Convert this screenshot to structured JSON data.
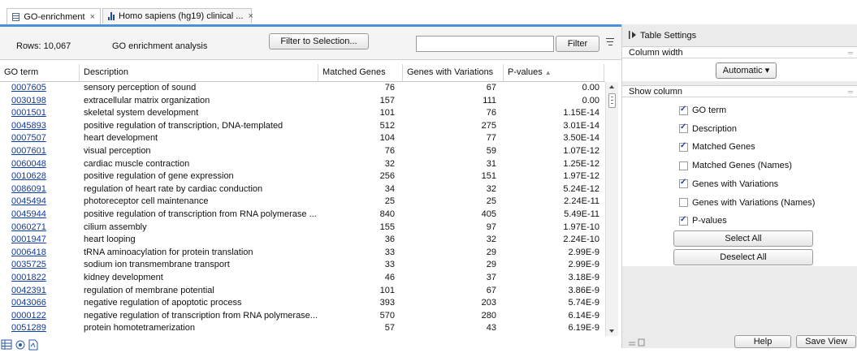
{
  "tabs": [
    {
      "label": "GO-enrichment",
      "icon": "table-icon",
      "close": "×"
    },
    {
      "label": "Homo sapiens (hg19) clinical ...",
      "icon": "bar-chart-icon",
      "close": "×"
    }
  ],
  "toolbar": {
    "rows_label": "Rows: 10,067",
    "analysis_label": "GO enrichment analysis",
    "filter_selection_button": "Filter to Selection...",
    "filter_input_value": "",
    "filter_button": "Filter"
  },
  "table": {
    "columns": [
      "GO term",
      "Description",
      "Matched Genes",
      "Genes with Variations",
      "P-values"
    ],
    "sort_indicator": "▲",
    "rows": [
      [
        "0007605",
        "sensory perception of sound",
        "76",
        "67",
        "0.00"
      ],
      [
        "0030198",
        "extracellular matrix organization",
        "157",
        "111",
        "0.00"
      ],
      [
        "0001501",
        "skeletal system development",
        "101",
        "76",
        "1.15E-14"
      ],
      [
        "0045893",
        "positive regulation of transcription, DNA-templated",
        "512",
        "275",
        "3.01E-14"
      ],
      [
        "0007507",
        "heart development",
        "104",
        "77",
        "3.50E-14"
      ],
      [
        "0007601",
        "visual perception",
        "76",
        "59",
        "1.07E-12"
      ],
      [
        "0060048",
        "cardiac muscle contraction",
        "32",
        "31",
        "1.25E-12"
      ],
      [
        "0010628",
        "positive regulation of gene expression",
        "256",
        "151",
        "1.97E-12"
      ],
      [
        "0086091",
        "regulation of heart rate by cardiac conduction",
        "34",
        "32",
        "5.24E-12"
      ],
      [
        "0045494",
        "photoreceptor cell maintenance",
        "25",
        "25",
        "2.24E-11"
      ],
      [
        "0045944",
        "positive regulation of transcription from RNA polymerase ...",
        "840",
        "405",
        "5.49E-11"
      ],
      [
        "0060271",
        "cilium assembly",
        "155",
        "97",
        "1.97E-10"
      ],
      [
        "0001947",
        "heart looping",
        "36",
        "32",
        "2.24E-10"
      ],
      [
        "0006418",
        "tRNA aminoacylation for protein translation",
        "33",
        "29",
        "2.99E-9"
      ],
      [
        "0035725",
        "sodium ion transmembrane transport",
        "33",
        "29",
        "2.99E-9"
      ],
      [
        "0001822",
        "kidney development",
        "46",
        "37",
        "3.18E-9"
      ],
      [
        "0042391",
        "regulation of membrane potential",
        "101",
        "67",
        "3.86E-9"
      ],
      [
        "0043066",
        "negative regulation of apoptotic process",
        "393",
        "203",
        "5.74E-9"
      ],
      [
        "0000122",
        "negative regulation of transcription from RNA polymerase...",
        "570",
        "280",
        "6.14E-9"
      ],
      [
        "0051289",
        "protein homotetramerization",
        "57",
        "43",
        "6.19E-9"
      ]
    ]
  },
  "side": {
    "title": "Table Settings",
    "column_width_label": "Column width",
    "column_width_value": "Automatic",
    "show_column_label": "Show column",
    "checkboxes": [
      {
        "label": "GO term",
        "checked": true
      },
      {
        "label": "Description",
        "checked": true
      },
      {
        "label": "Matched Genes",
        "checked": true
      },
      {
        "label": "Matched Genes (Names)",
        "checked": false
      },
      {
        "label": "Genes with Variations",
        "checked": true
      },
      {
        "label": "Genes with Variations (Names)",
        "checked": false
      },
      {
        "label": "P-values",
        "checked": true
      }
    ],
    "select_all": "Select All",
    "deselect_all": "Deselect All",
    "help_button": "Help",
    "save_view_button": "Save View"
  },
  "colors": {
    "accent": "#4a90d9",
    "link": "#0b3ba8",
    "panel_bg": "#ebebeb"
  }
}
